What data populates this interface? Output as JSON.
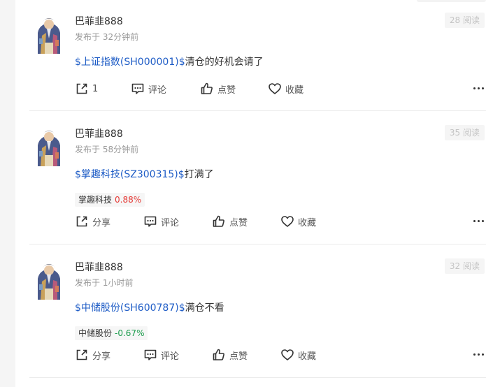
{
  "posts": [
    {
      "author": "巴菲韭888",
      "time": "发布于 32分钟前",
      "views": "28 阅读",
      "stock_link": "$上证指数(SH000001)$",
      "text": "清仓的好机会请了",
      "share_label": "1",
      "comment_label": "评论",
      "like_label": "点赞",
      "fav_label": "收藏"
    },
    {
      "author": "巴菲韭888",
      "time": "发布于 58分钟前",
      "views": "35 阅读",
      "stock_link": "$掌趣科技(SZ300315)$",
      "text": "打满了",
      "tag_name": "掌趣科技",
      "tag_change": "0.88%",
      "tag_color": "#e53935",
      "share_label": "分享",
      "comment_label": "评论",
      "like_label": "点赞",
      "fav_label": "收藏"
    },
    {
      "author": "巴菲韭888",
      "time": "发布于 1小时前",
      "views": "32 阅读",
      "stock_link": "$中储股份(SH600787)$",
      "text": "满仓不看",
      "tag_name": "中储股份",
      "tag_change": "-0.67%",
      "tag_color": "#1a9b4b",
      "share_label": "分享",
      "comment_label": "评论",
      "like_label": "点赞",
      "fav_label": "收藏"
    }
  ],
  "colors": {
    "link": "#1e5cc6",
    "up": "#e53935",
    "down": "#1a9b4b"
  }
}
